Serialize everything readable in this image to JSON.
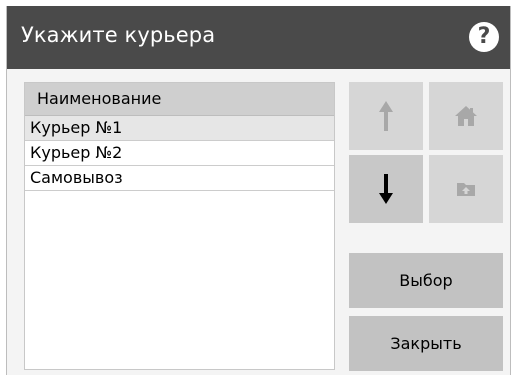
{
  "dialog": {
    "title": "Укажите курьера",
    "help_symbol": "?"
  },
  "list": {
    "header": "Наименование",
    "items": [
      {
        "label": "Курьер №1",
        "selected": true
      },
      {
        "label": "Курьер №2",
        "selected": false
      },
      {
        "label": "Самовывоз",
        "selected": false
      }
    ]
  },
  "buttons": {
    "select_label": "Выбор",
    "close_label": "Закрыть",
    "up_icon": "arrow-up-icon",
    "down_icon": "arrow-down-icon",
    "home_icon": "home-icon",
    "folder_up_icon": "folder-up-icon"
  },
  "colors": {
    "titlebar": "#4a4a4a",
    "action_button": "#c2c2c2",
    "disabled_icon": "#a8a8a8"
  }
}
